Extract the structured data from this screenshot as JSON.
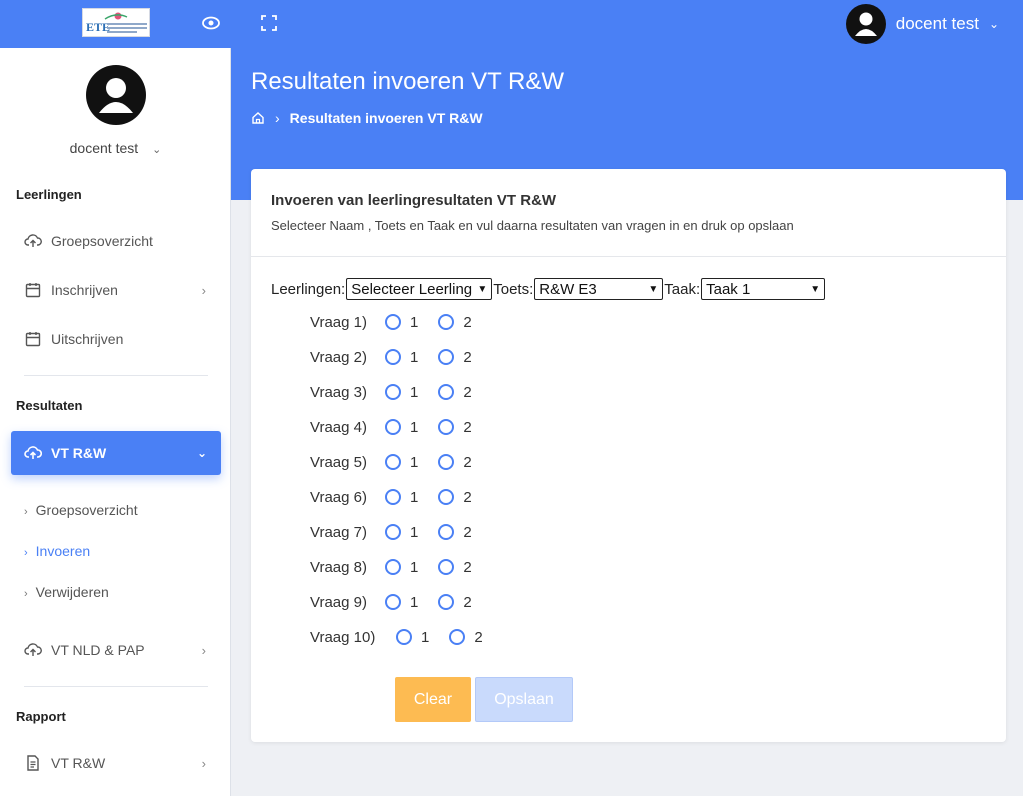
{
  "topbar": {
    "logo_text": "ETE",
    "user_name": "docent test",
    "icons": [
      "eye-icon",
      "expand-icon",
      "user-avatar-icon",
      "chevron-down-icon"
    ]
  },
  "sidebar": {
    "user_name": "docent test",
    "sections": {
      "leerlingen": "Leerlingen",
      "resultaten": "Resultaten",
      "rapport": "Rapport"
    },
    "items": {
      "groepsoverzicht": "Groepsoverzicht",
      "inschrijven": "Inschrijven",
      "uitschrijven": "Uitschrijven",
      "vt_rw": "VT R&W",
      "sub_groepsoverzicht": "Groepsoverzicht",
      "sub_invoeren": "Invoeren",
      "sub_verwijderen": "Verwijderen",
      "vt_nld_pap": "VT NLD & PAP",
      "rapport_vt_rw": "VT R&W"
    }
  },
  "header": {
    "title": "Resultaten invoeren VT R&W",
    "breadcrumb_current": "Resultaten invoeren VT R&W"
  },
  "card": {
    "title": "Invoeren van leerlingresultaten VT R&W",
    "subtitle": "Selecteer Naam , Toets en Taak en vul daarna resultaten van vragen in en druk op opslaan",
    "leerlingen_label": "Leerlingen:",
    "leerlingen_value": "Selecteer Leerling",
    "toets_label": "Toets:",
    "toets_value": "R&W E3",
    "taak_label": "Taak:",
    "taak_value": "Taak 1",
    "questions": [
      {
        "label": "Vraag 1)",
        "opt1": "1",
        "opt2": "2"
      },
      {
        "label": "Vraag 2)",
        "opt1": "1",
        "opt2": "2"
      },
      {
        "label": "Vraag 3)",
        "opt1": "1",
        "opt2": "2"
      },
      {
        "label": "Vraag 4)",
        "opt1": "1",
        "opt2": "2"
      },
      {
        "label": "Vraag 5)",
        "opt1": "1",
        "opt2": "2"
      },
      {
        "label": "Vraag 6)",
        "opt1": "1",
        "opt2": "2"
      },
      {
        "label": "Vraag 7)",
        "opt1": "1",
        "opt2": "2"
      },
      {
        "label": "Vraag 8)",
        "opt1": "1",
        "opt2": "2"
      },
      {
        "label": "Vraag 9)",
        "opt1": "1",
        "opt2": "2"
      },
      {
        "label": "Vraag 10)",
        "opt1": "1",
        "opt2": "2"
      }
    ],
    "clear_label": "Clear",
    "save_label": "Opslaan"
  },
  "colors": {
    "primary": "#4a80f5",
    "clear_button": "#fdbb52",
    "save_button_disabled": "#c9dafc"
  }
}
